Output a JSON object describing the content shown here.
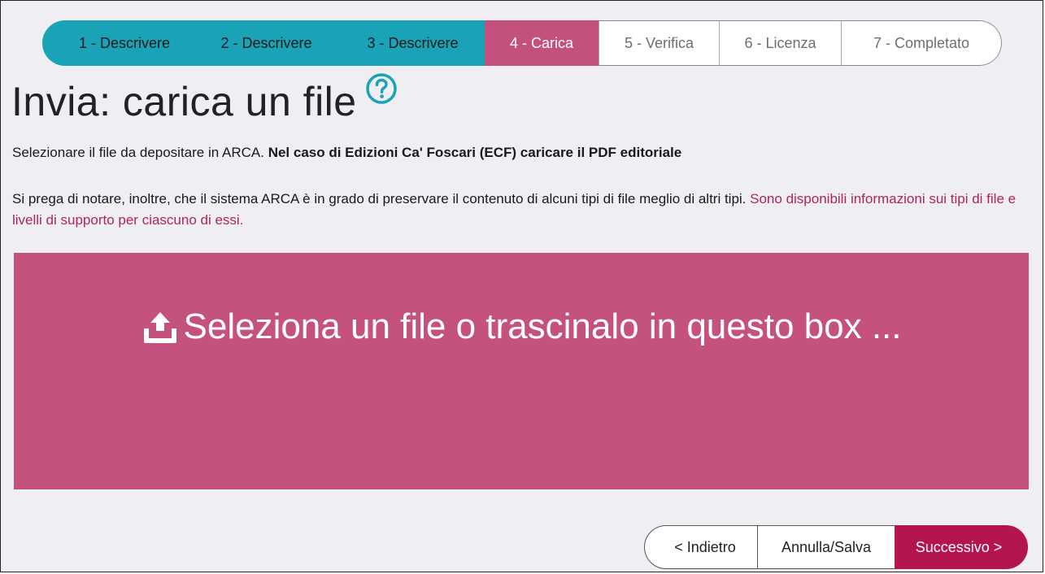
{
  "stepper": {
    "steps": [
      {
        "label": "1 - Descrivere",
        "state": "done"
      },
      {
        "label": "2 - Descrivere",
        "state": "done"
      },
      {
        "label": "3 - Descrivere",
        "state": "done"
      },
      {
        "label": "4 - Carica",
        "state": "current"
      },
      {
        "label": "5 - Verifica",
        "state": "todo"
      },
      {
        "label": "6 - Licenza",
        "state": "todo"
      },
      {
        "label": "7 - Completato",
        "state": "todo"
      }
    ]
  },
  "header": {
    "title": "Invia: carica un file",
    "help_icon": "question-circle-icon"
  },
  "intro": {
    "text_plain": "Selezionare il file da depositare in ARCA.",
    "text_bold": "Nel caso di Edizioni Ca' Foscari (ECF) caricare il PDF editoriale"
  },
  "note": {
    "text": "Si prega di notare, inoltre, che il sistema ARCA è in grado di preservare il contenuto di alcuni tipi di file meglio di altri tipi.",
    "link_text": "Sono disponibili informazioni sui tipi di file e livelli di supporto per ciascuno di essi."
  },
  "dropzone": {
    "label": "Seleziona un file o trascinalo in questo box ...",
    "icon": "upload-icon"
  },
  "buttons": {
    "back": "< Indietro",
    "save": "Annulla/Salva",
    "next": "Successivo >"
  },
  "colors": {
    "step_done": "#1aa2b7",
    "step_current": "#c4507c",
    "dropzone": "#c4517e",
    "next_button": "#b5154e",
    "link": "#b0245e",
    "help_icon": "#1aa2b7"
  }
}
